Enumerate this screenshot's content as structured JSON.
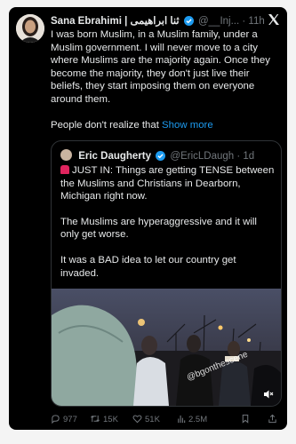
{
  "tweet": {
    "name": "Sana Ebrahimi | ثنا ابراهیمی",
    "handle": "@__Inj...",
    "time": "· 11h",
    "paragraph1": "I was born Muslim, in a Muslim family, under a Muslim government. I will never move to a city where Muslims are the majority again. Once they become the majority, they don't just live their beliefs, they start imposing them on everyone around them.",
    "paragraph2": "People don't realize that",
    "show_more": "Show more"
  },
  "quote": {
    "name": "Eric Daugherty",
    "handle": "@EricLDaugh",
    "time": "· 1d",
    "paragraph1": "JUST IN: Things are getting TENSE between the Muslims and Christians in Dearborn, Michigan right now.",
    "paragraph2": "The Muslims are hyperaggressive and it will only get worse.",
    "paragraph3": "It was a BAD idea to let our country get invaded.",
    "watermark": "@bgonthescene"
  },
  "actions": {
    "replies": "977",
    "reposts": "15K",
    "likes": "51K",
    "views": "2.5M"
  },
  "colors": {
    "background": "#000000",
    "text": "#e7e9ea",
    "muted": "#71767b",
    "link": "#1d9bf0",
    "verified": "#1d9bf0"
  },
  "icons": [
    "x-logo-icon",
    "verified-icon",
    "reply-icon",
    "repost-icon",
    "like-icon",
    "views-icon",
    "bookmark-icon",
    "share-icon",
    "sound-icon"
  ]
}
